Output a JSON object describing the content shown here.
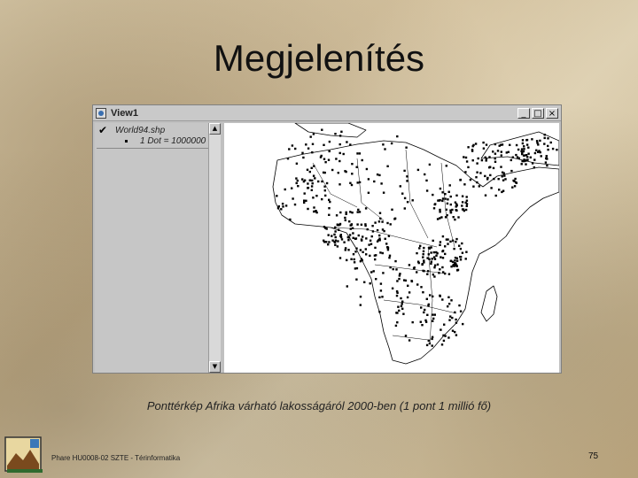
{
  "slide": {
    "title": "Megjelenítés",
    "caption": "Ponttérkép Afrika várható lakosságáról 2000-ben (1 pont 1 millió fő)",
    "footer": "Phare HU0008-02 SZTE - Térinformatika",
    "page_number": "75"
  },
  "window": {
    "title": "View1",
    "buttons": {
      "minimize": "_",
      "maximize": "□",
      "close": "×"
    }
  },
  "legend": {
    "layer_name": "World94.shp",
    "legend_entry": "1 Dot = 1000000",
    "checked": true
  },
  "colors": {
    "map_background": "#ffffff",
    "dot": "#000000",
    "window_gray": "#c0c0c0"
  }
}
